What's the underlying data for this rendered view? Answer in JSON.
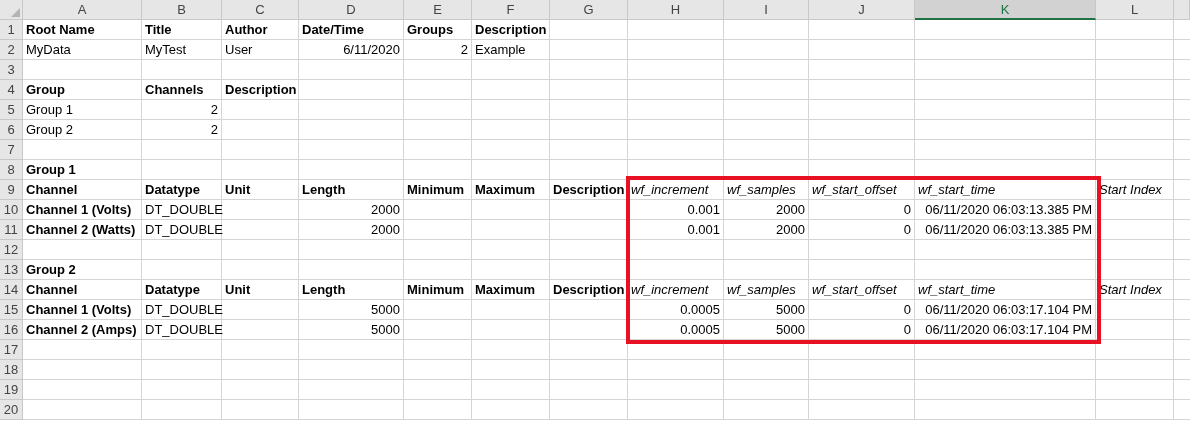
{
  "columns": [
    {
      "label": "A",
      "selected": false
    },
    {
      "label": "B",
      "selected": false
    },
    {
      "label": "C",
      "selected": false
    },
    {
      "label": "D",
      "selected": false
    },
    {
      "label": "E",
      "selected": false
    },
    {
      "label": "F",
      "selected": false
    },
    {
      "label": "G",
      "selected": false
    },
    {
      "label": "H",
      "selected": false
    },
    {
      "label": "I",
      "selected": false
    },
    {
      "label": "J",
      "selected": false
    },
    {
      "label": "K",
      "selected": true
    },
    {
      "label": "L",
      "selected": false
    }
  ],
  "rows": [
    {
      "number": "1",
      "cells": [
        {
          "text": "Root Name",
          "kind": "bold"
        },
        {
          "text": "Title",
          "kind": "bold"
        },
        {
          "text": "Author",
          "kind": "bold"
        },
        {
          "text": "Date/Time",
          "kind": "bold"
        },
        {
          "text": "Groups",
          "kind": "bold"
        },
        {
          "text": "Description",
          "kind": "bold"
        }
      ]
    },
    {
      "number": "2",
      "cells": [
        {
          "text": "MyData",
          "kind": "text"
        },
        {
          "text": "MyTest",
          "kind": "text"
        },
        {
          "text": "User",
          "kind": "text"
        },
        {
          "text": "6/11/2020",
          "kind": "number"
        },
        {
          "text": "2",
          "kind": "number"
        },
        {
          "text": "Example",
          "kind": "text"
        }
      ]
    },
    {
      "number": "3"
    },
    {
      "number": "4",
      "cells": [
        {
          "text": "Group",
          "kind": "bold"
        },
        {
          "text": "Channels",
          "kind": "bold"
        },
        {
          "text": "Description",
          "kind": "bold"
        }
      ]
    },
    {
      "number": "5",
      "cells": [
        {
          "text": "Group 1",
          "kind": "text"
        },
        {
          "text": "2",
          "kind": "number"
        }
      ]
    },
    {
      "number": "6",
      "cells": [
        {
          "text": "Group 2",
          "kind": "text"
        },
        {
          "text": "2",
          "kind": "number"
        }
      ]
    },
    {
      "number": "7"
    },
    {
      "number": "8",
      "cells": [
        {
          "text": "Group 1",
          "kind": "bold"
        }
      ]
    },
    {
      "number": "9",
      "cells": [
        {
          "text": "Channel",
          "kind": "bold"
        },
        {
          "text": "Datatype",
          "kind": "bold"
        },
        {
          "text": "Unit",
          "kind": "bold"
        },
        {
          "text": "Length",
          "kind": "bold"
        },
        {
          "text": "Minimum",
          "kind": "bold"
        },
        {
          "text": "Maximum",
          "kind": "bold"
        },
        {
          "text": "Description",
          "kind": "bold"
        },
        {
          "text": "wf_increment",
          "kind": "italic"
        },
        {
          "text": "wf_samples",
          "kind": "italic"
        },
        {
          "text": "wf_start_offset",
          "kind": "italic"
        },
        {
          "text": "wf_start_time",
          "kind": "italic"
        },
        {
          "text": "Start Index",
          "kind": "italic"
        }
      ]
    },
    {
      "number": "10",
      "cells": [
        {
          "text": "Channel 1 (Volts)",
          "kind": "bold"
        },
        {
          "text": "DT_DOUBLE",
          "kind": "text"
        },
        null,
        {
          "text": "2000",
          "kind": "number"
        },
        null,
        null,
        null,
        {
          "text": "0.001",
          "kind": "number"
        },
        {
          "text": "2000",
          "kind": "number"
        },
        {
          "text": "0",
          "kind": "number"
        },
        {
          "text": "06/11/2020 06:03:13.385 PM",
          "kind": "number"
        }
      ]
    },
    {
      "number": "11",
      "cells": [
        {
          "text": "Channel 2 (Watts)",
          "kind": "bold"
        },
        {
          "text": "DT_DOUBLE",
          "kind": "text"
        },
        null,
        {
          "text": "2000",
          "kind": "number"
        },
        null,
        null,
        null,
        {
          "text": "0.001",
          "kind": "number"
        },
        {
          "text": "2000",
          "kind": "number"
        },
        {
          "text": "0",
          "kind": "number"
        },
        {
          "text": "06/11/2020 06:03:13.385 PM",
          "kind": "number"
        }
      ]
    },
    {
      "number": "12"
    },
    {
      "number": "13",
      "cells": [
        {
          "text": "Group 2",
          "kind": "bold"
        }
      ]
    },
    {
      "number": "14",
      "cells": [
        {
          "text": "Channel",
          "kind": "bold"
        },
        {
          "text": "Datatype",
          "kind": "bold"
        },
        {
          "text": "Unit",
          "kind": "bold"
        },
        {
          "text": "Length",
          "kind": "bold"
        },
        {
          "text": "Minimum",
          "kind": "bold"
        },
        {
          "text": "Maximum",
          "kind": "bold"
        },
        {
          "text": "Description",
          "kind": "bold"
        },
        {
          "text": "wf_increment",
          "kind": "italic"
        },
        {
          "text": "wf_samples",
          "kind": "italic"
        },
        {
          "text": "wf_start_offset",
          "kind": "italic"
        },
        {
          "text": "wf_start_time",
          "kind": "italic"
        },
        {
          "text": "Start Index",
          "kind": "italic"
        }
      ]
    },
    {
      "number": "15",
      "cells": [
        {
          "text": "Channel 1 (Volts)",
          "kind": "bold"
        },
        {
          "text": "DT_DOUBLE",
          "kind": "text"
        },
        null,
        {
          "text": "5000",
          "kind": "number"
        },
        null,
        null,
        null,
        {
          "text": "0.0005",
          "kind": "number"
        },
        {
          "text": "5000",
          "kind": "number"
        },
        {
          "text": "0",
          "kind": "number"
        },
        {
          "text": "06/11/2020 06:03:17.104 PM",
          "kind": "number"
        }
      ]
    },
    {
      "number": "16",
      "cells": [
        {
          "text": "Channel 2 (Amps)",
          "kind": "bold"
        },
        {
          "text": "DT_DOUBLE",
          "kind": "text"
        },
        null,
        {
          "text": "5000",
          "kind": "number"
        },
        null,
        null,
        null,
        {
          "text": "0.0005",
          "kind": "number"
        },
        {
          "text": "5000",
          "kind": "number"
        },
        {
          "text": "0",
          "kind": "number"
        },
        {
          "text": "06/11/2020 06:03:17.104 PM",
          "kind": "number"
        }
      ]
    },
    {
      "number": "17"
    },
    {
      "number": "18"
    },
    {
      "number": "19"
    },
    {
      "number": "20"
    }
  ]
}
